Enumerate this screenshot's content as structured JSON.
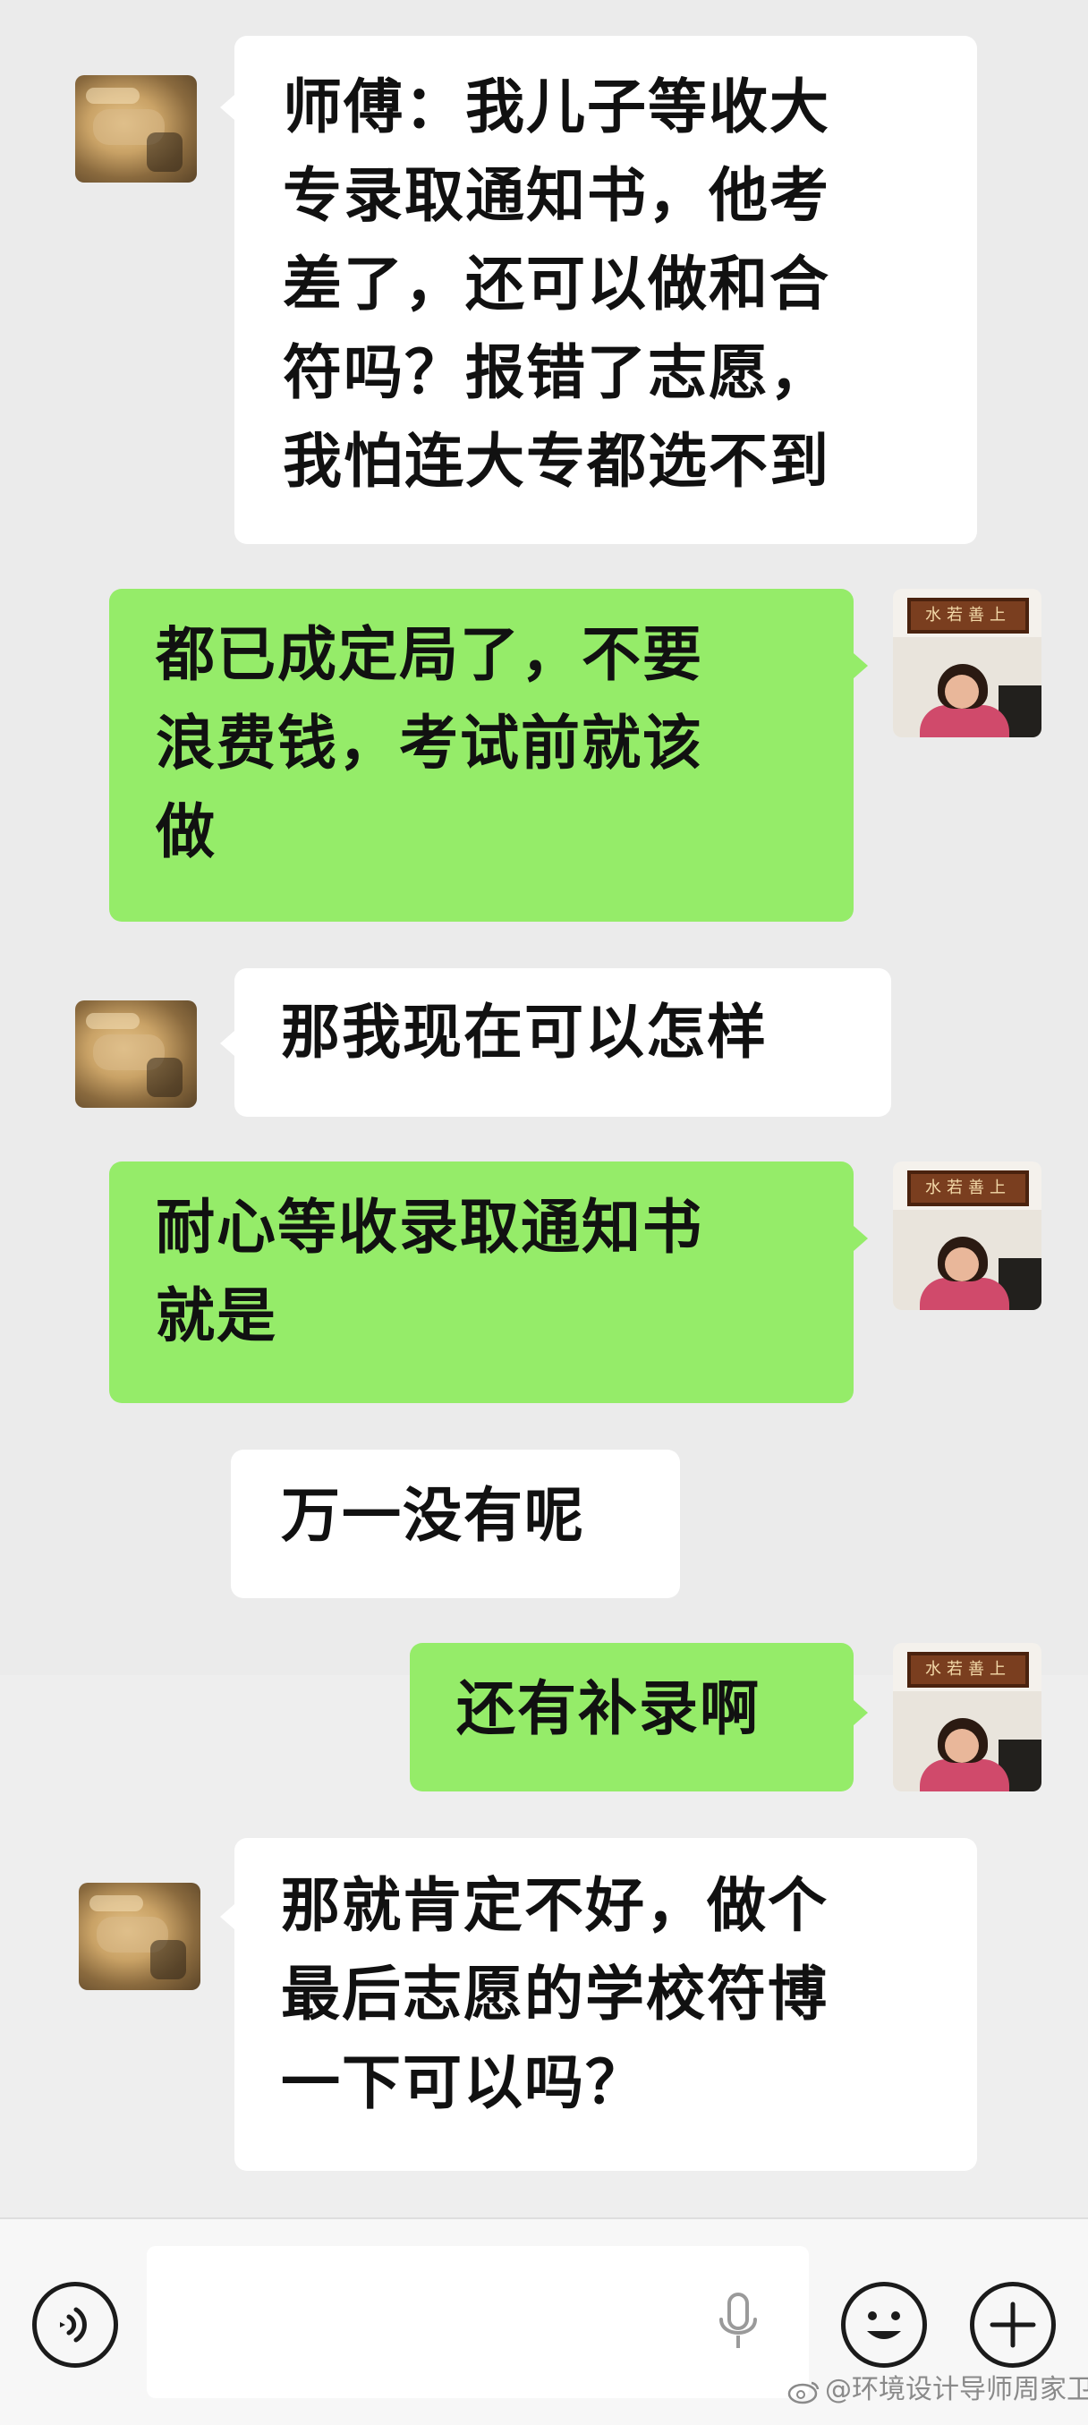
{
  "messages": [
    {
      "sender": "other",
      "text": "师傅：我儿子等收大\n专录取通知书，他考\n差了，还可以做和合\n符吗？报错了志愿，\n我怕连大专都选不到"
    },
    {
      "sender": "self",
      "text": "都已成定局了，不要\n浪费钱，考试前就该\n做"
    },
    {
      "sender": "other",
      "text": "那我现在可以怎样"
    },
    {
      "sender": "self",
      "text": "耐心等收录取通知书\n就是"
    },
    {
      "sender": "other",
      "text": "万一没有呢"
    },
    {
      "sender": "self",
      "text": "还有补录啊"
    },
    {
      "sender": "other",
      "text": "那就肯定不好，做个\n最后志愿的学校符博\n一下可以吗？"
    }
  ],
  "self_avatar": {
    "plaque_text": "水若善上"
  },
  "input_bar": {
    "value": "",
    "left_icon": "voice-icon",
    "mic_icon": "microphone-icon",
    "emoji_icon": "emoji-icon",
    "plus_icon": "plus-icon"
  },
  "watermark": {
    "text": "@环境设计导师周家卫"
  },
  "colors": {
    "self_bubble": "#95ec69",
    "other_bubble": "#ffffff",
    "background": "#ededed"
  }
}
